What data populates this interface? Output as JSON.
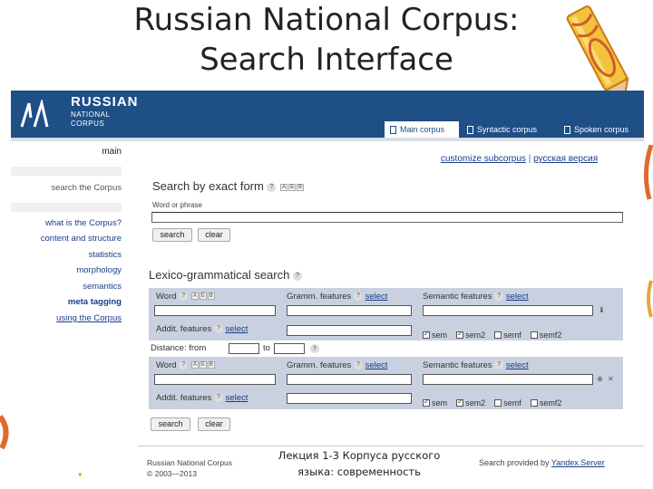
{
  "slide": {
    "title_line1": "Russian National Corpus:",
    "title_line2": "Search Interface",
    "lecture_line1": "Лекция 1-3 Корпуса русского",
    "lecture_line2": "языка: современность"
  },
  "colors": {
    "banner": "#1e4f86",
    "link": "#1a3c8a",
    "row_bg": "#c9d1e0"
  },
  "header": {
    "brand_line1": "RUSSIAN",
    "brand_line2": "NATIONAL",
    "brand_line3": "CORPUS",
    "tabs": [
      {
        "label": "Main corpus",
        "active": true
      },
      {
        "label": "Syntactic corpus",
        "active": false
      },
      {
        "label": "Spoken corpus",
        "active": false
      }
    ]
  },
  "sidebar": {
    "main": "main",
    "search": "search the Corpus",
    "items": [
      {
        "label": "what is the Corpus?"
      },
      {
        "label": "content and structure"
      },
      {
        "label": "statistics"
      },
      {
        "label": "morphology"
      },
      {
        "label": "semantics"
      },
      {
        "label": "meta tagging"
      },
      {
        "label": "using the Corpus"
      }
    ]
  },
  "top_links": {
    "customize": "customize subcorpus",
    "sep": "|",
    "russian": "русская версия"
  },
  "exact_search": {
    "heading": "Search by exact form",
    "help": "?",
    "kbd": [
      "А",
      "Б",
      "В"
    ],
    "field_label": "Word or phrase",
    "value": "",
    "search_label": "search",
    "clear_label": "clear"
  },
  "lexgram": {
    "heading": "Lexico-grammatical search",
    "help": "?",
    "word_label": "Word",
    "gramm_label": "Gramm. features",
    "semantic_label": "Semantic features",
    "addit_label": "Addit. features",
    "select_label": "select",
    "distance_label": "Distance: from",
    "to_label": "to",
    "checkboxes": [
      {
        "label": "sem",
        "checked": true
      },
      {
        "label": "sem2",
        "checked": true
      },
      {
        "label": "semf",
        "checked": false
      },
      {
        "label": "semf2",
        "checked": false
      }
    ],
    "kbd": [
      "А",
      "Б",
      "В"
    ],
    "search_label": "search",
    "clear_label": "clear"
  },
  "footer": {
    "name": "Russian National Corpus",
    "copyright": "© 2003—2013",
    "search_provided": "Search provided by",
    "provider": "Yandex.Server"
  },
  "icons": [
    "pencil-decoration-icon",
    "logo-mark-icon",
    "help-icon",
    "add-icon",
    "remove-icon",
    "down-arrow-icon"
  ]
}
